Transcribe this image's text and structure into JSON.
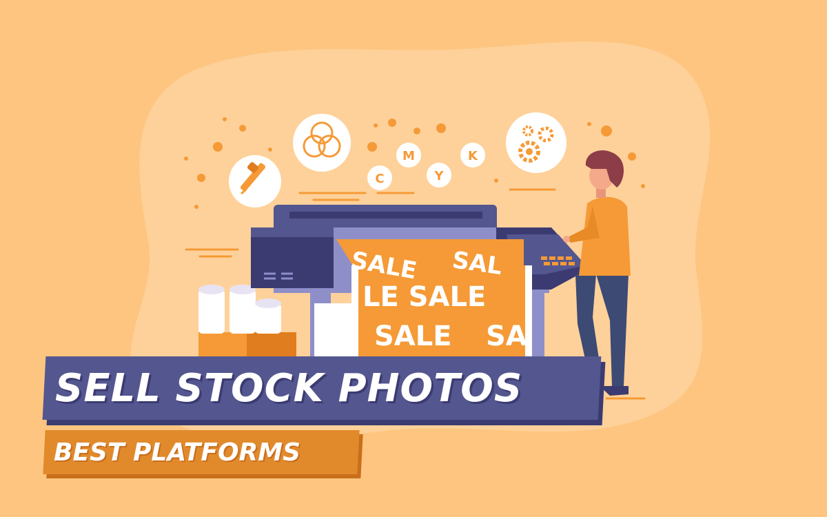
{
  "headline": {
    "title": "SELL STOCK PHOTOS",
    "subtitle": "BEST PLATFORMS"
  },
  "illustration": {
    "cmyk_letters": [
      "C",
      "M",
      "Y",
      "K"
    ],
    "sale_text": [
      "SALE",
      "SAL",
      "LE SALE",
      "SALE",
      "SA"
    ]
  },
  "colors": {
    "background": "#fdc57f",
    "blob": "#fed19a",
    "accent_orange": "#f59a36",
    "navy": "#54568f",
    "navy_dark": "#3b3b72"
  },
  "icons": [
    "color-picker-icon",
    "color-circles-icon",
    "gears-icon"
  ]
}
